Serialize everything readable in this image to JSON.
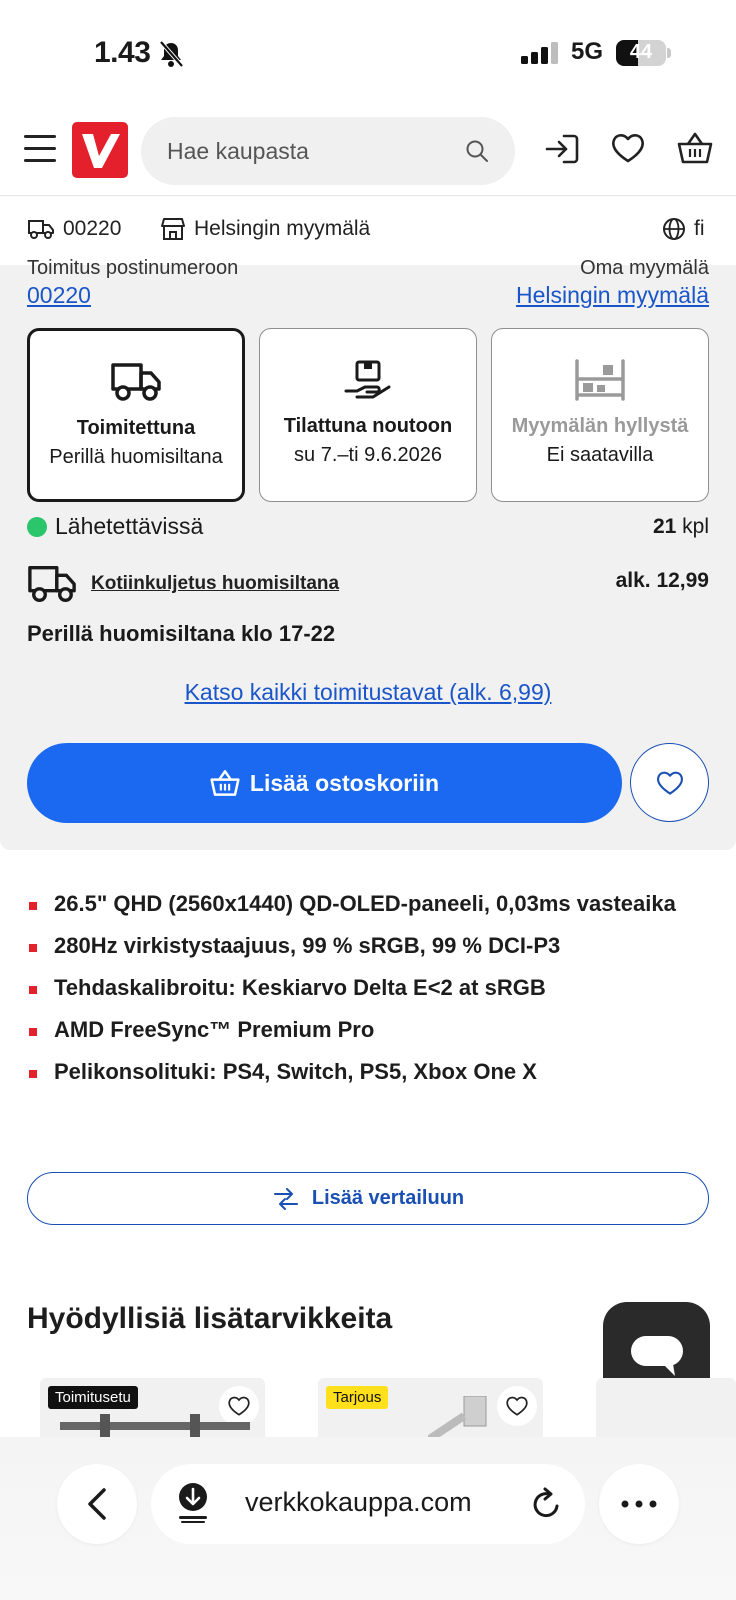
{
  "status_bar": {
    "time": "1.43",
    "network": "5G",
    "battery": "44",
    "battery_level": 0.44
  },
  "header": {
    "logo_letter": "V",
    "search_placeholder": "Hae kaupasta"
  },
  "location_bar": {
    "zip": "00220",
    "store": "Helsingin myymälä",
    "language": "fi"
  },
  "delivery": {
    "zip_label": "Toimitus postinumeroon",
    "store_label": "Oma myymälä",
    "zip_link": "00220",
    "store_link": "Helsingin myymälä",
    "options": [
      {
        "title": "Toimitettuna",
        "subtitle": "Perillä huomisiltana",
        "icon": "truck-icon"
      },
      {
        "title": "Tilattuna noutoon",
        "subtitle": "su 7.–ti 9.6.2026",
        "icon": "pickup-icon"
      },
      {
        "title": "Myymälän hyllystä",
        "subtitle": "Ei saatavilla",
        "icon": "shelf-icon"
      }
    ],
    "stock_status": "Lähetettävissä",
    "stock_qty": "21",
    "stock_unit": "kpl",
    "shipping_method": "Kotiinkuljetus huomisiltana",
    "shipping_price": "alk. 12,99",
    "arrival": "Perillä huomisiltana klo 17-22",
    "all_methods_link": "Katso kaikki toimitustavat (alk. 6,99)",
    "add_to_cart": "Lisää ostoskoriin"
  },
  "features": [
    "26.5\" QHD (2560x1440) QD-OLED-paneeli, 0,03ms vasteaika",
    "280Hz virkistystaajuus, 99 % sRGB, 99 % DCI-P3",
    "Tehdaskalibroitu: Keskiarvo Delta E<2 at sRGB",
    "AMD FreeSync™ Premium Pro",
    "Pelikonsolituki: PS4, Switch, PS5, Xbox One X"
  ],
  "compare_button": "Lisää vertailuun",
  "accessories": {
    "title": "Hyödyllisiä lisätarvikkeita",
    "badges": [
      "Toimitusetu",
      "Tarjous"
    ]
  },
  "browser": {
    "url": "verkkokauppa.com"
  },
  "colors": {
    "accent": "#1b69f0",
    "brand_red": "#e3202b",
    "link": "#1a55c9",
    "in_stock": "#2bc56b"
  }
}
